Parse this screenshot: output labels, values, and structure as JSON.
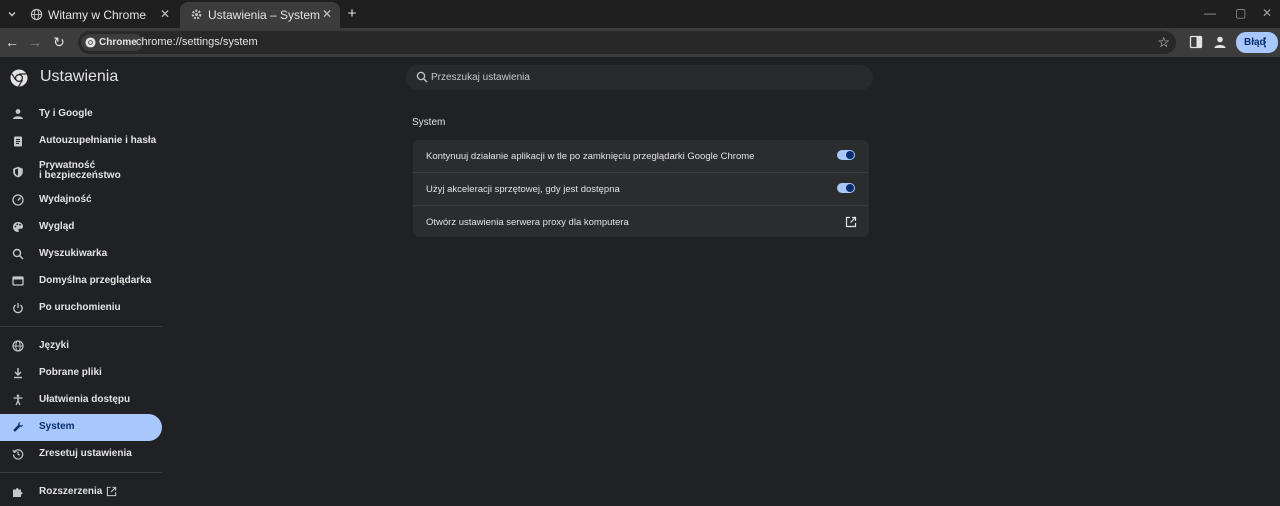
{
  "tabs": [
    {
      "title": "Witamy w Chrome",
      "active": false
    },
    {
      "title": "Ustawienia – System",
      "active": true
    }
  ],
  "toolbar": {
    "chip_label": "Chrome",
    "url": "chrome://settings/system",
    "profile_label": "Błąd"
  },
  "header": {
    "title": "Ustawienia",
    "search_placeholder": "Przeszukaj ustawienia"
  },
  "sidebar": {
    "items": [
      {
        "label": "Ty i Google",
        "icon": "person-icon"
      },
      {
        "label": "Autouzupełnianie i hasła",
        "icon": "clipboard-icon"
      },
      {
        "label": "Prywatność\ni bezpieczeństwo",
        "icon": "shield-icon"
      },
      {
        "label": "Wydajność",
        "icon": "speedometer-icon"
      },
      {
        "label": "Wygląd",
        "icon": "palette-icon"
      },
      {
        "label": "Wyszukiwarka",
        "icon": "search-icon"
      },
      {
        "label": "Domyślna przeglądarka",
        "icon": "browser-icon"
      },
      {
        "label": "Po uruchomieniu",
        "icon": "power-icon"
      },
      {
        "label": "Języki",
        "icon": "globe-icon"
      },
      {
        "label": "Pobrane pliki",
        "icon": "download-icon"
      },
      {
        "label": "Ułatwienia dostępu",
        "icon": "accessibility-icon"
      },
      {
        "label": "System",
        "icon": "wrench-icon",
        "active": true
      },
      {
        "label": "Zresetuj ustawienia",
        "icon": "history-icon"
      },
      {
        "label": "Rozszerzenia",
        "icon": "puzzle-icon"
      }
    ]
  },
  "main": {
    "section_title": "System",
    "rows": [
      {
        "label": "Kontynuuj działanie aplikacji w tle po zamknięciu przeglądarki Google Chrome",
        "control": "toggle",
        "on": true
      },
      {
        "label": "Użyj akceleracji sprzętowej, gdy jest dostępna",
        "control": "toggle",
        "on": true
      },
      {
        "label": "Otwórz ustawienia serwera proxy dla komputera",
        "control": "external-link"
      }
    ]
  },
  "colors": {
    "accent": "#a8c7fa",
    "background": "#202124",
    "card": "#2b2c2e"
  }
}
